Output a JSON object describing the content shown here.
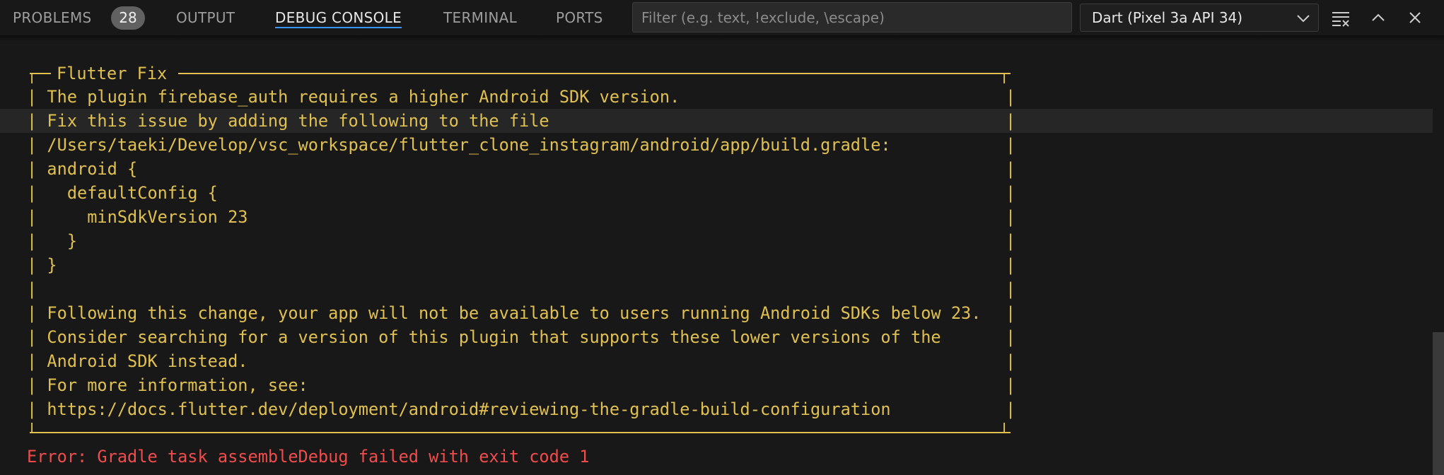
{
  "tabs": {
    "problems_label": "PROBLEMS",
    "problems_count": "28",
    "output_label": "OUTPUT",
    "debug_console_label": "DEBUG CONSOLE",
    "terminal_label": "TERMINAL",
    "ports_label": "PORTS",
    "active": "DEBUG CONSOLE"
  },
  "filter": {
    "placeholder": "Filter (e.g. text, !exclude, \\escape)",
    "value": ""
  },
  "session_select": {
    "value": "Dart (Pixel 3a API 34)",
    "icon": "chevron-down-icon"
  },
  "toolbar_icons": [
    "clear-console-icon",
    "chevron-up-icon",
    "close-icon"
  ],
  "console": {
    "box_title": "Flutter Fix",
    "lines": [
      "| The plugin firebase_auth requires a higher Android SDK version.",
      "| Fix this issue by adding the following to the file",
      "| /Users/taeki/Develop/vsc_workspace/flutter_clone_instagram/android/app/build.gradle:",
      "| android {",
      "|   defaultConfig {",
      "|     minSdkVersion 23",
      "|   }",
      "| }",
      "|",
      "| Following this change, your app will not be available to users running Android SDKs below 23.",
      "| Consider searching for a version of this plugin that supports these lower versions of the",
      "| Android SDK instead.",
      "| For more information, see:",
      "| https://docs.flutter.dev/deployment/android#reviewing-the-gradle-build-configuration"
    ],
    "right_border": "|",
    "error": "Error: Gradle task assembleDebug failed with exit code 1"
  },
  "colors": {
    "background": "#181818",
    "warning_text": "#e0c050",
    "error_text": "#f14c4c",
    "active_tab_underline": "#3794ff",
    "badge_bg": "#616161"
  }
}
